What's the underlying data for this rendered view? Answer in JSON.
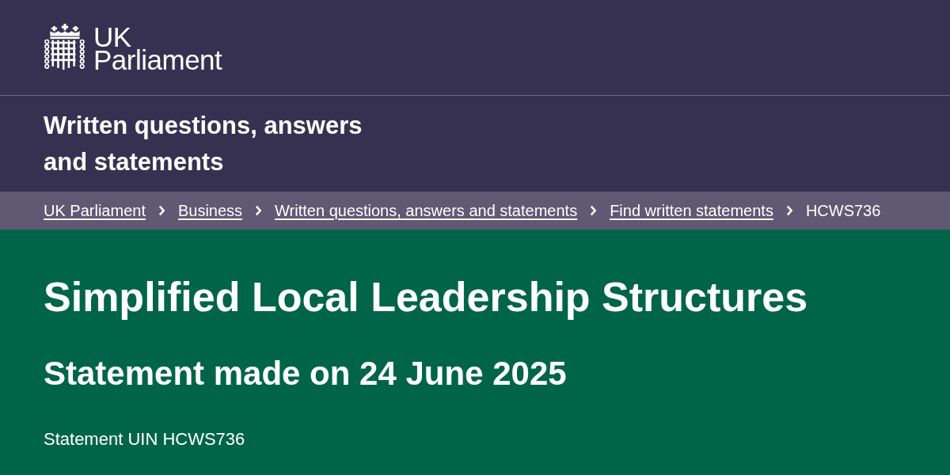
{
  "header": {
    "logo": {
      "lines": [
        "UK",
        "Parliament"
      ]
    },
    "section_title": "Written questions, answers and statements"
  },
  "breadcrumb": [
    {
      "label": "UK Parliament",
      "current": false
    },
    {
      "label": "Business",
      "current": false
    },
    {
      "label": "Written questions, answers and statements",
      "current": false
    },
    {
      "label": "Find written statements",
      "current": false
    },
    {
      "label": "HCWS736",
      "current": true
    }
  ],
  "statement": {
    "title": "Simplified Local Leadership Structures",
    "date_line": "Statement made on 24 June 2025",
    "uin": "Statement UIN HCWS736"
  }
}
